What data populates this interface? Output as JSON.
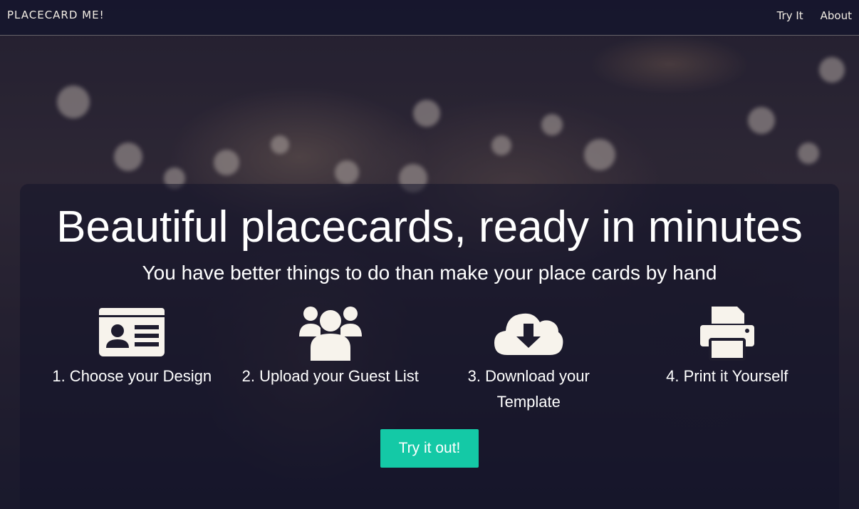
{
  "navbar": {
    "brand": "PLACECARD ME!",
    "links": [
      "Try It",
      "About"
    ]
  },
  "hero": {
    "title": "Beautiful placecards, ready in minutes",
    "subtitle": "You have better things to do than make your place cards by hand",
    "steps": [
      {
        "icon": "id-card-icon",
        "label": "1. Choose your Design"
      },
      {
        "icon": "users-icon",
        "label": "2. Upload your Guest List"
      },
      {
        "icon": "cloud-download-icon",
        "label": "3. Download your Template"
      },
      {
        "icon": "printer-icon",
        "label": "4. Print it Yourself"
      }
    ],
    "cta_label": "Try it out!"
  },
  "colors": {
    "accent": "#14c9a6",
    "navbar": "#16162c",
    "icon": "#f7f3ec"
  }
}
